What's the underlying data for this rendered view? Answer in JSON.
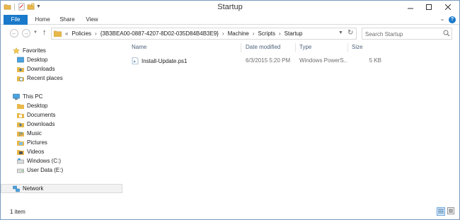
{
  "window": {
    "title": "Startup"
  },
  "ribbon": {
    "tabs": [
      "File",
      "Home",
      "Share",
      "View"
    ]
  },
  "address": {
    "overflow": "«",
    "crumbs": [
      "Policies",
      "{3B3BEA00-0887-4207-8D02-035D84B4B3E9}",
      "Machine",
      "Scripts",
      "Startup"
    ],
    "separator": "›"
  },
  "search": {
    "placeholder": "Search Startup"
  },
  "nav": {
    "favorites": {
      "label": "Favorites",
      "items": [
        "Desktop",
        "Downloads",
        "Recent places"
      ]
    },
    "thispc": {
      "label": "This PC",
      "items": [
        "Desktop",
        "Documents",
        "Downloads",
        "Music",
        "Pictures",
        "Videos",
        "Windows (C:)",
        "User Data (E:)"
      ]
    },
    "network": {
      "label": "Network"
    }
  },
  "columns": {
    "name": "Name",
    "date": "Date modified",
    "type": "Type",
    "size": "Size"
  },
  "files": [
    {
      "name": "Install-Update.ps1",
      "date": "6/3/2015 5:20 PM",
      "type": "Windows PowerS...",
      "size": "5 KB"
    }
  ],
  "status": {
    "count": "1 item"
  },
  "colors": {
    "accent": "#1979ca",
    "folder": "#e8b84a",
    "header_text": "#4c607a"
  }
}
